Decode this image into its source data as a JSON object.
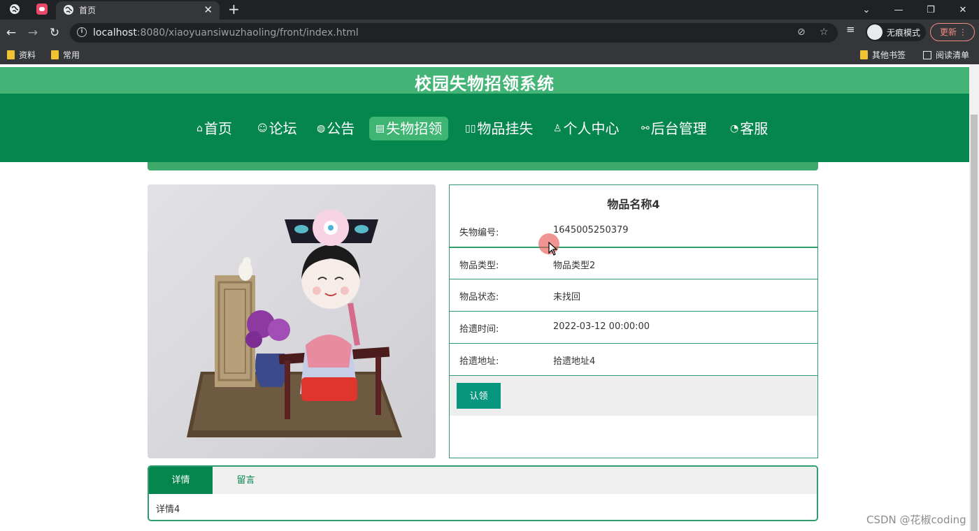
{
  "browser": {
    "tab_title": "首页",
    "tab_close": "✕",
    "new_tab": "+",
    "url_host": "localhost",
    "url_rest": ":8080/xiaoyuansiwuzhaoling/front/index.html",
    "incognito_label": "无痕模式",
    "update_label": "更新",
    "bookmarks": [
      "资料",
      "常用"
    ],
    "bookmarks_right": [
      "其他书签",
      "阅读清单"
    ]
  },
  "site": {
    "title": "校园失物招领系统",
    "nav": [
      {
        "icon": "⌂",
        "label": "首页"
      },
      {
        "icon": "☺",
        "label": "论坛"
      },
      {
        "icon": "◍",
        "label": "公告"
      },
      {
        "icon": "▤",
        "label": "失物招领",
        "active": true
      },
      {
        "icon": "▯▯",
        "label": "物品挂失"
      },
      {
        "icon": "♙",
        "label": "个人中心"
      },
      {
        "icon": "⚯",
        "label": "后台管理"
      },
      {
        "icon": "◔",
        "label": "客服"
      }
    ]
  },
  "item": {
    "name": "物品名称4",
    "fields": [
      {
        "label": "失物编号:",
        "value": "1645005250379"
      },
      {
        "label": "物品类型:",
        "value": "物品类型2"
      },
      {
        "label": "物品状态:",
        "value": "未找回"
      },
      {
        "label": "拾遗时间:",
        "value": "2022-03-12 00:00:00"
      },
      {
        "label": "拾遗地址:",
        "value": "拾遗地址4"
      }
    ],
    "claim_button": "认领"
  },
  "detail_tabs": {
    "tabs": [
      "详情",
      "留言"
    ],
    "content": "详情4"
  },
  "watermark": "CSDN @花椒coding",
  "colors": {
    "header_green": "#43b475",
    "nav_green": "#04864e",
    "active_nav": "#3fb574",
    "claim_button": "#08967e",
    "border_green": "#2f9d6e"
  }
}
